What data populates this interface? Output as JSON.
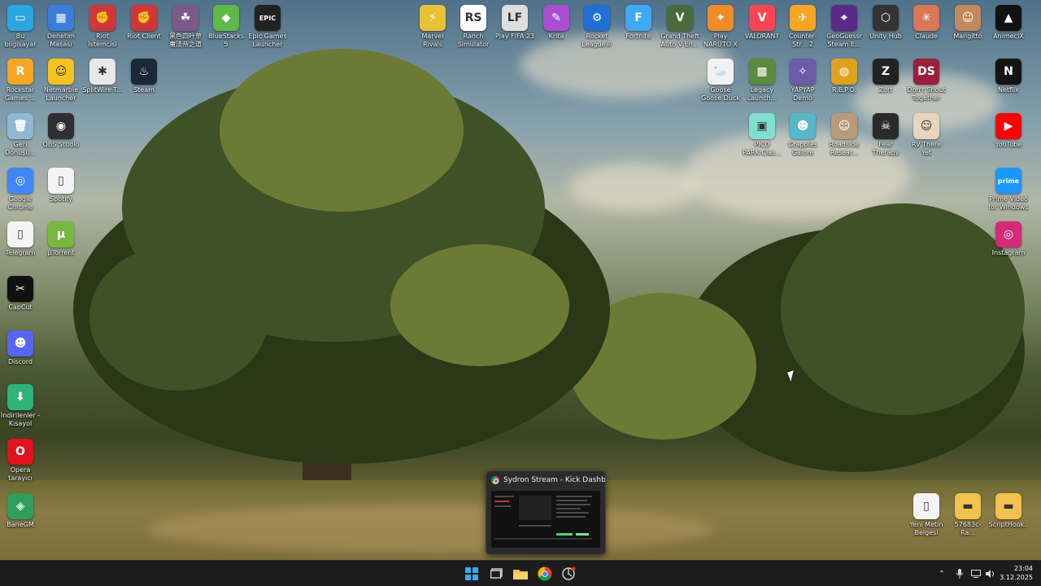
{
  "desktop": {
    "icons_left": [
      {
        "label": "Bu bilgisayar",
        "icon": "monitor-icon",
        "color": "#2aa6e0",
        "glyph": "▭"
      },
      {
        "label": "Denetim Masası",
        "icon": "control-panel-icon",
        "color": "#3b7dd8",
        "glyph": "▦"
      },
      {
        "label": "Riot İstemcisi",
        "icon": "riot-icon",
        "color": "#d13639",
        "glyph": "✊"
      },
      {
        "label": "Riot Client",
        "icon": "riot-icon",
        "color": "#d13639",
        "glyph": "✊"
      },
      {
        "label": "黑色四叶草 魔法帝之道",
        "icon": "anime-game-icon",
        "color": "#7b5a8a",
        "glyph": "☘"
      },
      {
        "label": "BlueStacks 5",
        "icon": "bluestacks-icon",
        "color": "#5fb84a",
        "glyph": "◆"
      },
      {
        "label": "Epic Games Launcher",
        "icon": "epic-games-icon",
        "color": "#222222",
        "glyph": "EPIC"
      },
      {
        "label": "Rockstar Games ...",
        "icon": "rockstar-icon",
        "color": "#f5a623",
        "glyph": "R"
      },
      {
        "label": "Netmarble Launcher",
        "icon": "netmarble-icon",
        "color": "#f6c21e",
        "glyph": "☺"
      },
      {
        "label": "SplitWire-T...",
        "icon": "splitwire-icon",
        "color": "#e8e8e8",
        "glyph": "✱"
      },
      {
        "label": "Steam",
        "icon": "steam-icon",
        "color": "#1b2838",
        "glyph": "♨"
      },
      {
        "label": "Geri Dönüşü...",
        "icon": "recycle-bin-icon",
        "color": "#8fb7d6",
        "glyph": "🗑"
      },
      {
        "label": "OBS Studio",
        "icon": "obs-icon",
        "color": "#302e31",
        "glyph": "◉"
      },
      {
        "label": "Google Chrome",
        "icon": "chrome-icon",
        "color": "#4285f4",
        "glyph": "◎"
      },
      {
        "label": "Spotify",
        "icon": "file-icon",
        "color": "#f4f4f4",
        "glyph": "▯"
      },
      {
        "label": "Telegram",
        "icon": "file-icon",
        "color": "#f4f4f4",
        "glyph": "▯"
      },
      {
        "label": "µTorrent",
        "icon": "utorrent-icon",
        "color": "#76b83f",
        "glyph": "µ"
      },
      {
        "label": "CapCut",
        "icon": "capcut-icon",
        "color": "#111111",
        "glyph": "✂"
      },
      {
        "label": "Discord",
        "icon": "discord-icon",
        "color": "#5865f2",
        "glyph": "☻"
      },
      {
        "label": "İndirilenler - Kısayol",
        "icon": "downloads-icon",
        "color": "#2fb37a",
        "glyph": "⬇"
      },
      {
        "label": "Opera tarayıcı",
        "icon": "opera-icon",
        "color": "#e0121e",
        "glyph": "O"
      },
      {
        "label": "BaneGM",
        "icon": "banegm-icon",
        "color": "#2e9e5a",
        "glyph": "◈"
      }
    ],
    "icons_right": [
      {
        "label": "Marvel Rivals",
        "icon": "marvel-rivals-icon",
        "color": "#e7c236",
        "glyph": "⚡"
      },
      {
        "label": "Ranch Simulator",
        "icon": "ranch-sim-icon",
        "color": "#ffffff",
        "glyph": "RS"
      },
      {
        "label": "Play FIFA 23",
        "icon": "fifa-icon",
        "color": "#dedede",
        "glyph": "LF"
      },
      {
        "label": "Krita",
        "icon": "krita-icon",
        "color": "#a74fd0",
        "glyph": "✎"
      },
      {
        "label": "Rocket League®",
        "icon": "rocket-league-icon",
        "color": "#1f6fd6",
        "glyph": "⚙"
      },
      {
        "label": "Fortnite",
        "icon": "fortnite-icon",
        "color": "#3fa9f5",
        "glyph": "F"
      },
      {
        "label": "Grand Theft Auto V En...",
        "icon": "gta-icon",
        "color": "#4b6b3a",
        "glyph": "V"
      },
      {
        "label": "Play NARUTO X BORUTO ...",
        "icon": "naruto-icon",
        "color": "#f08b2a",
        "glyph": "✦"
      },
      {
        "label": "VALORANT",
        "icon": "valorant-icon",
        "color": "#fa4454",
        "glyph": "V"
      },
      {
        "label": "Counter-Str... 2",
        "icon": "cs2-icon",
        "color": "#f5a623",
        "glyph": "✈"
      },
      {
        "label": "GeoGuessr Steam E...",
        "icon": "geoguessr-icon",
        "color": "#5b2a86",
        "glyph": "⌖"
      },
      {
        "label": "Unity Hub",
        "icon": "unity-icon",
        "color": "#333333",
        "glyph": "⬡"
      },
      {
        "label": "Claude",
        "icon": "claude-icon",
        "color": "#d97757",
        "glyph": "✳"
      },
      {
        "label": "Mangitto",
        "icon": "mangitto-icon",
        "color": "#c28a5c",
        "glyph": "☺"
      },
      {
        "label": "AnimeciX",
        "icon": "animecix-icon",
        "color": "#111111",
        "glyph": "▲"
      },
      {
        "label": "Goose Goose Duck",
        "icon": "goose-duck-icon",
        "color": "#f2f2f2",
        "glyph": "🦢"
      },
      {
        "label": "Legacy Launch...",
        "icon": "minecraft-icon",
        "color": "#5b8a3c",
        "glyph": "▩"
      },
      {
        "label": "YAPYAP Demo",
        "icon": "yapyap-icon",
        "color": "#6b5ba8",
        "glyph": "✧"
      },
      {
        "label": "R.E.P.O.",
        "icon": "repo-icon",
        "color": "#e0a21e",
        "glyph": "◍"
      },
      {
        "label": "Zort",
        "icon": "zort-icon",
        "color": "#222222",
        "glyph": "Z"
      },
      {
        "label": "Don't Shout Together",
        "icon": "dont-shout-icon",
        "color": "#9a1f3a",
        "glyph": "DS"
      },
      {
        "label": "Netflix",
        "icon": "netflix-icon",
        "color": "#141414",
        "glyph": "N"
      },
      {
        "label": "PICO PARK:Clas...",
        "icon": "pico-park-icon",
        "color": "#7fe0d2",
        "glyph": "▣"
      },
      {
        "label": "Grapples Galore",
        "icon": "grapples-icon",
        "color": "#56b7c9",
        "glyph": "☻"
      },
      {
        "label": "Roadside Resear...",
        "icon": "roadside-icon",
        "color": "#b89a7a",
        "glyph": "☺"
      },
      {
        "label": "Fear Therapy",
        "icon": "fear-therapy-icon",
        "color": "#2a2a2a",
        "glyph": "☠"
      },
      {
        "label": "RV There Yet",
        "icon": "rv-there-yet-icon",
        "color": "#e8d5c0",
        "glyph": "☺"
      },
      {
        "label": "YouTube",
        "icon": "youtube-icon",
        "color": "#ff0000",
        "glyph": "▶"
      },
      {
        "label": "Prime Video for Windows",
        "icon": "prime-video-icon",
        "color": "#1a98ff",
        "glyph": "prime"
      },
      {
        "label": "Instagram",
        "icon": "instagram-icon",
        "color": "#d6297a",
        "glyph": "◎"
      }
    ],
    "icons_bottom_right": [
      {
        "label": "Yeni Metin Belgesi",
        "icon": "text-file-icon",
        "color": "#f4f4f4",
        "glyph": "▯"
      },
      {
        "label": "57683c-Ra...",
        "icon": "folder-icon",
        "color": "#f2c14e",
        "glyph": "▬"
      },
      {
        "label": "ScriptHook...",
        "icon": "folder-icon",
        "color": "#f2c14e",
        "glyph": "▬"
      }
    ]
  },
  "preview": {
    "title": "Sydron Stream - Kick Dashb..."
  },
  "taskbar": {
    "time": "23:04",
    "date": "3.12.2025"
  }
}
